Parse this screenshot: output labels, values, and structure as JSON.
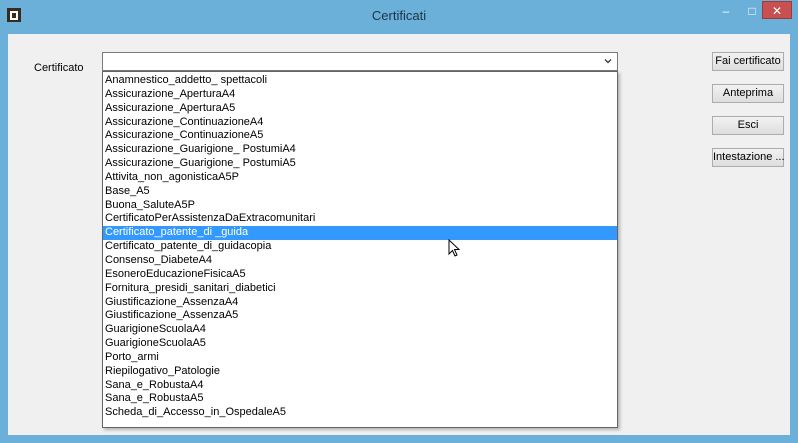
{
  "window": {
    "title": "Certificati"
  },
  "titlebar": {
    "minimize": "–",
    "maximize": "□",
    "close": "✕"
  },
  "form": {
    "certificate_label": "Certificato",
    "combo_value": ""
  },
  "dropdown": {
    "selected_index": 11,
    "items": [
      "Anamnestico_addetto_ spettacoli",
      "Assicurazione_AperturaA4",
      "Assicurazione_AperturaA5",
      "Assicurazione_ContinuazioneA4",
      "Assicurazione_ContinuazioneA5",
      "Assicurazione_Guarigione_ PostumiA4",
      "Assicurazione_Guarigione_ PostumiA5",
      "Attivita_non_agonisticaA5P",
      "Base_A5",
      "Buona_SaluteA5P",
      "CertificatoPerAssistenzaDaExtracomunitari",
      "Certificato_patente_di _guida",
      "Certificato_patente_di_guidacopia",
      "Consenso_DiabeteA4",
      "EsoneroEducazioneFisicaA5",
      "Fornitura_presidi_sanitari_diabetici",
      "Giustificazione_AssenzaA4",
      "Giustificazione_AssenzaA5",
      "GuarigioneScuolaA4",
      "GuarigioneScuolaA5",
      "Porto_armi",
      "Riepilogativo_Patologie",
      "Sana_e_RobustaA4",
      "Sana_e_RobustaA5",
      "Scheda_di_Accesso_in_OspedaleA5"
    ]
  },
  "buttons": {
    "make_certificate": "Fai certificato",
    "preview": "Anteprima",
    "exit": "Esci",
    "header": "Intestazione ..."
  },
  "colors": {
    "titlebar": "#6ab0d8",
    "selection": "#3399ff",
    "close": "#c75050"
  }
}
